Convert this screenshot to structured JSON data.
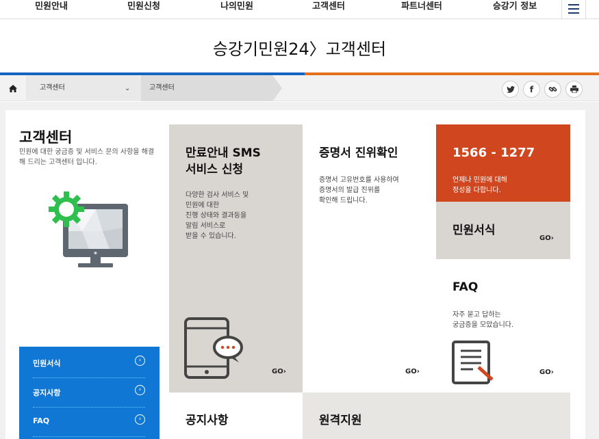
{
  "gnb": {
    "items": [
      "민원안내",
      "민원신청",
      "나의민원",
      "고객센터",
      "파트너센터",
      "승강기 정보"
    ],
    "menu_icon": "hamburger-icon"
  },
  "page_title": "승강기민원24〉고객센터",
  "location": {
    "home_icon": "home-icon",
    "level1": "고객센터",
    "level2": "고객센터",
    "share_icons": [
      "twitter-icon",
      "facebook-icon",
      "link-icon",
      "print-icon"
    ]
  },
  "sidebar": {
    "title": "고객센터",
    "desc": "민원에 대한 궁금증 및 서비스 문의 사항을 해결해 드리는 고객센터 입니다.",
    "illustration": "monitor-gear-icon",
    "nav": [
      "민원서식",
      "공지사항",
      "FAQ"
    ]
  },
  "cards": {
    "sms": {
      "title1": "만료안내 SMS",
      "title2": "서비스 신청",
      "desc": [
        "다양한 검사 서비스 및",
        "민원에 대한",
        "진행 상태와 결과등을",
        "알림 서비스로",
        "받을 수 있습니다."
      ],
      "go": "GO",
      "icon": "tablet-chat-icon"
    },
    "certificate": {
      "title": "증명서 진위확인",
      "desc": [
        "증명서 고유번호를 사용하여",
        "증명서의 발급 진위를",
        "확인해 드립니다."
      ],
      "go": "GO"
    },
    "phone": {
      "number": "1566 - 1277",
      "desc": [
        "언제나 민원에 대해",
        "정성을 다합니다."
      ],
      "color": "#d0461f"
    },
    "forms": {
      "title": "민원서식",
      "go": "GO"
    },
    "faq": {
      "title": "FAQ",
      "desc": [
        "자주 묻고 답하는",
        "궁금증을 모았습니다."
      ],
      "go": "GO",
      "icon": "document-pen-icon"
    },
    "notice": {
      "title": "공지사항"
    },
    "remote": {
      "title": "원격지원"
    }
  },
  "colors": {
    "blue": "#1565c0",
    "orange": "#e4701e",
    "nav_blue": "#1077d4",
    "gray_card": "#d9d6d2",
    "red_card": "#d0461f"
  }
}
